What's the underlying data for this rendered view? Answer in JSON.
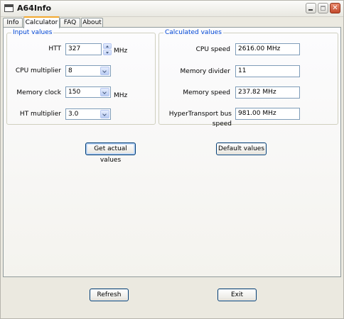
{
  "window": {
    "title": "A64Info",
    "close_glyph": "✕"
  },
  "tabs": [
    "Info",
    "Calculator",
    "FAQ",
    "About"
  ],
  "input_group": {
    "title": "Input values",
    "htt": {
      "label": "HTT",
      "value": "327",
      "unit": "MHz"
    },
    "cpu_multiplier": {
      "label": "CPU multiplier",
      "value": "8"
    },
    "memory_clock": {
      "label": "Memory clock",
      "value": "150",
      "unit": "MHz"
    },
    "ht_multiplier": {
      "label": "HT multiplier",
      "value": "3.0"
    }
  },
  "calc_group": {
    "title": "Calculated values",
    "cpu_speed": {
      "label": "CPU speed",
      "value": "2616.00 MHz"
    },
    "memory_divider": {
      "label": "Memory divider",
      "value": "11"
    },
    "memory_speed": {
      "label": "Memory speed",
      "value": "237.82 MHz"
    },
    "ht_bus_speed": {
      "label": "HyperTransport bus speed",
      "value": "981.00 MHz"
    }
  },
  "buttons": {
    "get_actual": "Get actual values",
    "default": "Default values",
    "refresh": "Refresh",
    "exit": "Exit"
  }
}
